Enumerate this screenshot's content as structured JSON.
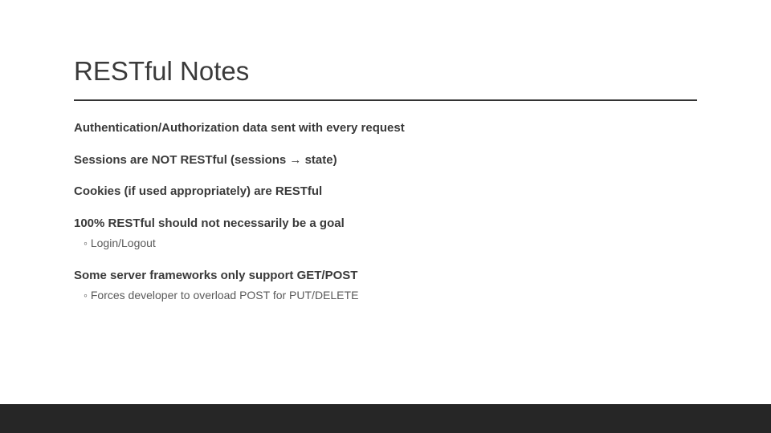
{
  "slide": {
    "title": "RESTful Notes",
    "bullets": {
      "b0": "Authentication/Authorization data sent with every request",
      "b1": "Sessions are NOT RESTful (sessions → state)",
      "b2": "Cookies (if used appropriately) are RESTful",
      "b3": "100% RESTful should not necessarily be a goal",
      "b3_sub": "Login/Logout",
      "b4": "Some server frameworks only support GET/POST",
      "b4_sub": "Forces developer to overload POST for PUT/DELETE"
    }
  }
}
